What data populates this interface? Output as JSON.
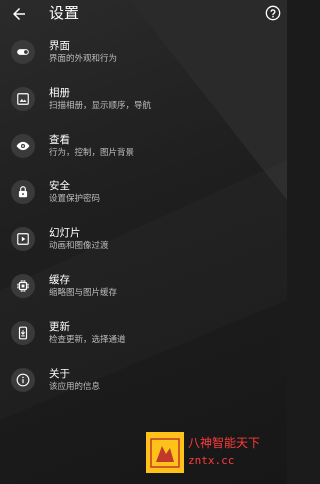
{
  "header": {
    "title": "设置",
    "back_icon": "arrow-left-icon",
    "help_icon": "help-circle-icon"
  },
  "items": [
    {
      "title": "界面",
      "subtitle": "界面的外观和行为",
      "icon": "toggle-icon"
    },
    {
      "title": "相册",
      "subtitle": "扫描相册，显示顺序，导航",
      "icon": "image-icon"
    },
    {
      "title": "查看",
      "subtitle": "行为，控制，图片背景",
      "icon": "eye-icon"
    },
    {
      "title": "安全",
      "subtitle": "设置保护密码",
      "icon": "lock-icon"
    },
    {
      "title": "幻灯片",
      "subtitle": "动画和图像过渡",
      "icon": "slideshow-icon"
    },
    {
      "title": "缓存",
      "subtitle": "缩略图与图片缓存",
      "icon": "chip-icon"
    },
    {
      "title": "更新",
      "subtitle": "检查更新，选择通道",
      "icon": "phone-update-icon"
    },
    {
      "title": "关于",
      "subtitle": "该应用的信息",
      "icon": "info-icon"
    }
  ],
  "watermark": {
    "line1": "八神智能天下",
    "line2": "zntx.cc"
  },
  "colors": {
    "background": "#1b1b1b",
    "icon_circle": "#3a3a3a",
    "watermark_red": "#ff3b3b",
    "watermark_yellow": "#ffc21a"
  }
}
